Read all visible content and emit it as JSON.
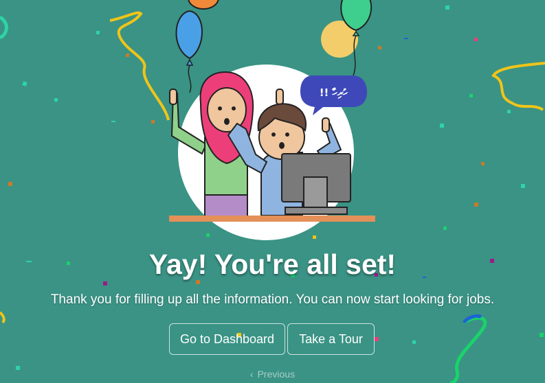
{
  "headline": "Yay! You're all set!",
  "message": "Thank you for filling up all the information. You can now start looking for jobs.",
  "buttons": {
    "dashboard": "Go to Dashboard",
    "tour": "Take a Tour"
  },
  "previous": {
    "label": "Previous",
    "icon": "chevron-left-icon"
  },
  "speech_bubble": {
    "text": "!! ހުރިހާ"
  },
  "colors": {
    "background": "#3a9385",
    "bubble": "#3e48b8",
    "hijab": "#ec3f79",
    "desk": "#e39059"
  }
}
